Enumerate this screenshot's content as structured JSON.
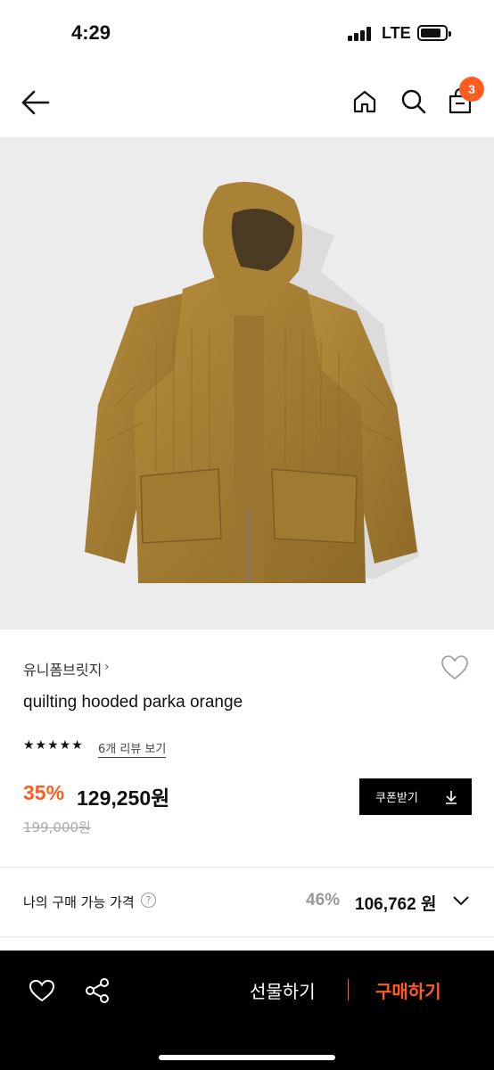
{
  "status_bar": {
    "time": "4:29",
    "network": "LTE"
  },
  "nav": {
    "cart_count": "3"
  },
  "product": {
    "brand": "유니폼브릿지",
    "brand_chevron": "›",
    "name": "quilting hooded parka orange",
    "stars": "★★★★★",
    "review_link": "6개 리뷰 보기",
    "discount": "35%",
    "price": "129,250원",
    "original_price": "199,000원",
    "coupon_label": "쿠폰받기"
  },
  "my_price": {
    "label": "나의 구매 가능 가격",
    "help": "?",
    "discount": "46%",
    "price": "106,762 원"
  },
  "bottom_bar": {
    "gift_label": "선물하기",
    "buy_label": "구매하기"
  },
  "colors": {
    "accent": "#ff5c21",
    "bottom_bar": "#000000",
    "image_bg": "#ececec"
  }
}
